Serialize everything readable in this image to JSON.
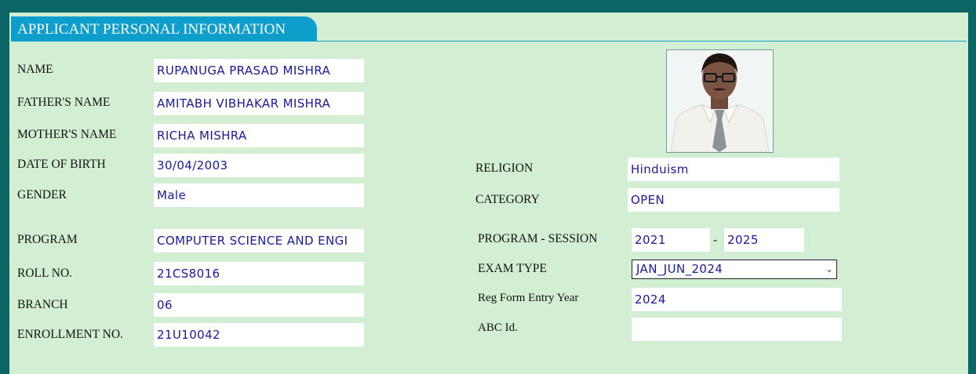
{
  "section_title": "APPLICANT PERSONAL INFORMATION",
  "left": {
    "name": {
      "label": "NAME",
      "value": "RUPANUGA PRASAD MISHRA"
    },
    "father": {
      "label": "FATHER'S NAME",
      "value": "AMITABH VIBHAKAR MISHRA"
    },
    "mother": {
      "label": "MOTHER'S NAME",
      "value": "RICHA MISHRA"
    },
    "dob": {
      "label": "DATE OF BIRTH",
      "value": "30/04/2003"
    },
    "gender": {
      "label": "GENDER",
      "value": "Male"
    },
    "program": {
      "label": "PROGRAM",
      "value": "COMPUTER SCIENCE AND ENGI"
    },
    "roll": {
      "label": "ROLL NO.",
      "value": "21CS8016"
    },
    "branch": {
      "label": "BRANCH",
      "value": "06"
    },
    "enrollment": {
      "label": "ENROLLMENT NO.",
      "value": "21U10042"
    }
  },
  "right": {
    "religion": {
      "label": "RELIGION",
      "value": "Hinduism"
    },
    "category": {
      "label": "CATEGORY",
      "value": "OPEN"
    },
    "session": {
      "label": "PROGRAM - SESSION",
      "start": "2021",
      "separator": "-",
      "end": "2025"
    },
    "exam_type": {
      "label": "EXAM TYPE",
      "value": "JAN_JUN_2024"
    },
    "reg_year": {
      "label": "Reg Form Entry Year",
      "value": "2024"
    },
    "abc": {
      "label": "ABC Id.",
      "value": ""
    }
  },
  "colors": {
    "background": "#0b6565",
    "panel": "#d3efd3",
    "header": "#0d9ecb",
    "value_text": "#1a1a9e"
  }
}
